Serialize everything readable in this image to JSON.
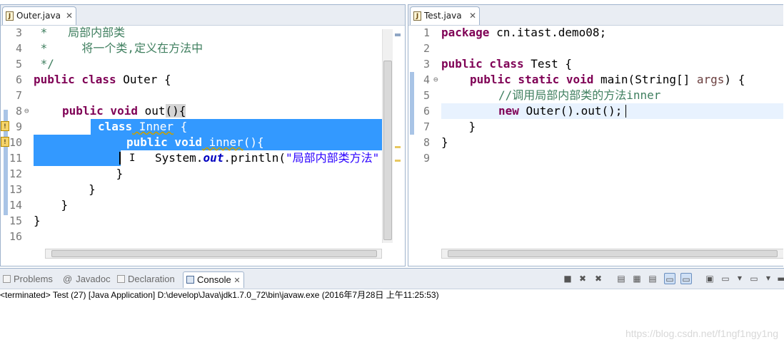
{
  "colors": {
    "keyword": "#7f0055",
    "comment": "#3f7f5f",
    "string": "#2a00ff",
    "selection": "#3399ff"
  },
  "left_editor": {
    "tab_label": "Outer.java",
    "tab_close": "✕",
    "lines": [
      {
        "n": "3",
        "text": " *   局部内部类"
      },
      {
        "n": "4",
        "text": " *     将一个类,定义在方法中"
      },
      {
        "n": "5",
        "text": " */"
      },
      {
        "n": "6",
        "a": "public class",
        "b": " Outer {"
      },
      {
        "n": "7",
        "text": ""
      },
      {
        "n": "8",
        "a": "public void",
        "b": " out",
        "c": "(){"
      },
      {
        "n": "9",
        "a": "class",
        "b": " Inner",
        "c": " {"
      },
      {
        "n": "10",
        "a": "public void",
        "b": " inner",
        "c": "(){"
      },
      {
        "n": "11",
        "pre": "System.",
        "fld": "out",
        "mid": ".println(",
        "str": "\"局部内部类方法\""
      },
      {
        "n": "12",
        "text": "            }"
      },
      {
        "n": "13",
        "text": "        }"
      },
      {
        "n": "14",
        "text": "    }"
      },
      {
        "n": "15",
        "text": "}"
      },
      {
        "n": "16",
        "text": ""
      }
    ]
  },
  "right_editor": {
    "tab_label": "Test.java",
    "tab_close": "✕",
    "lines": [
      {
        "n": "1",
        "a": "package",
        "b": " cn.itast.demo08;"
      },
      {
        "n": "2",
        "text": ""
      },
      {
        "n": "3",
        "a": "public class",
        "b": " Test {"
      },
      {
        "n": "4",
        "a": "public static void",
        "b": " main(String[] ",
        "c": "args",
        "d": ") {"
      },
      {
        "n": "5",
        "cm": "//调用局部内部类的方法inner"
      },
      {
        "n": "6",
        "a": "new",
        "b": " Outer().out();"
      },
      {
        "n": "7",
        "text": "    }"
      },
      {
        "n": "8",
        "text": "}"
      },
      {
        "n": "9",
        "text": ""
      }
    ]
  },
  "console_tabs": {
    "problems": "Problems",
    "javadoc": "Javadoc",
    "declaration": "Declaration",
    "console": "Console",
    "console_close": "✕"
  },
  "console_output": "<terminated> Test (27) [Java Application] D:\\develop\\Java\\jdk1.7.0_72\\bin\\javaw.exe (2016年7月28日 上午11:25:53)",
  "watermark": "https://blog.csdn.net/f1ngf1ngy1ng"
}
